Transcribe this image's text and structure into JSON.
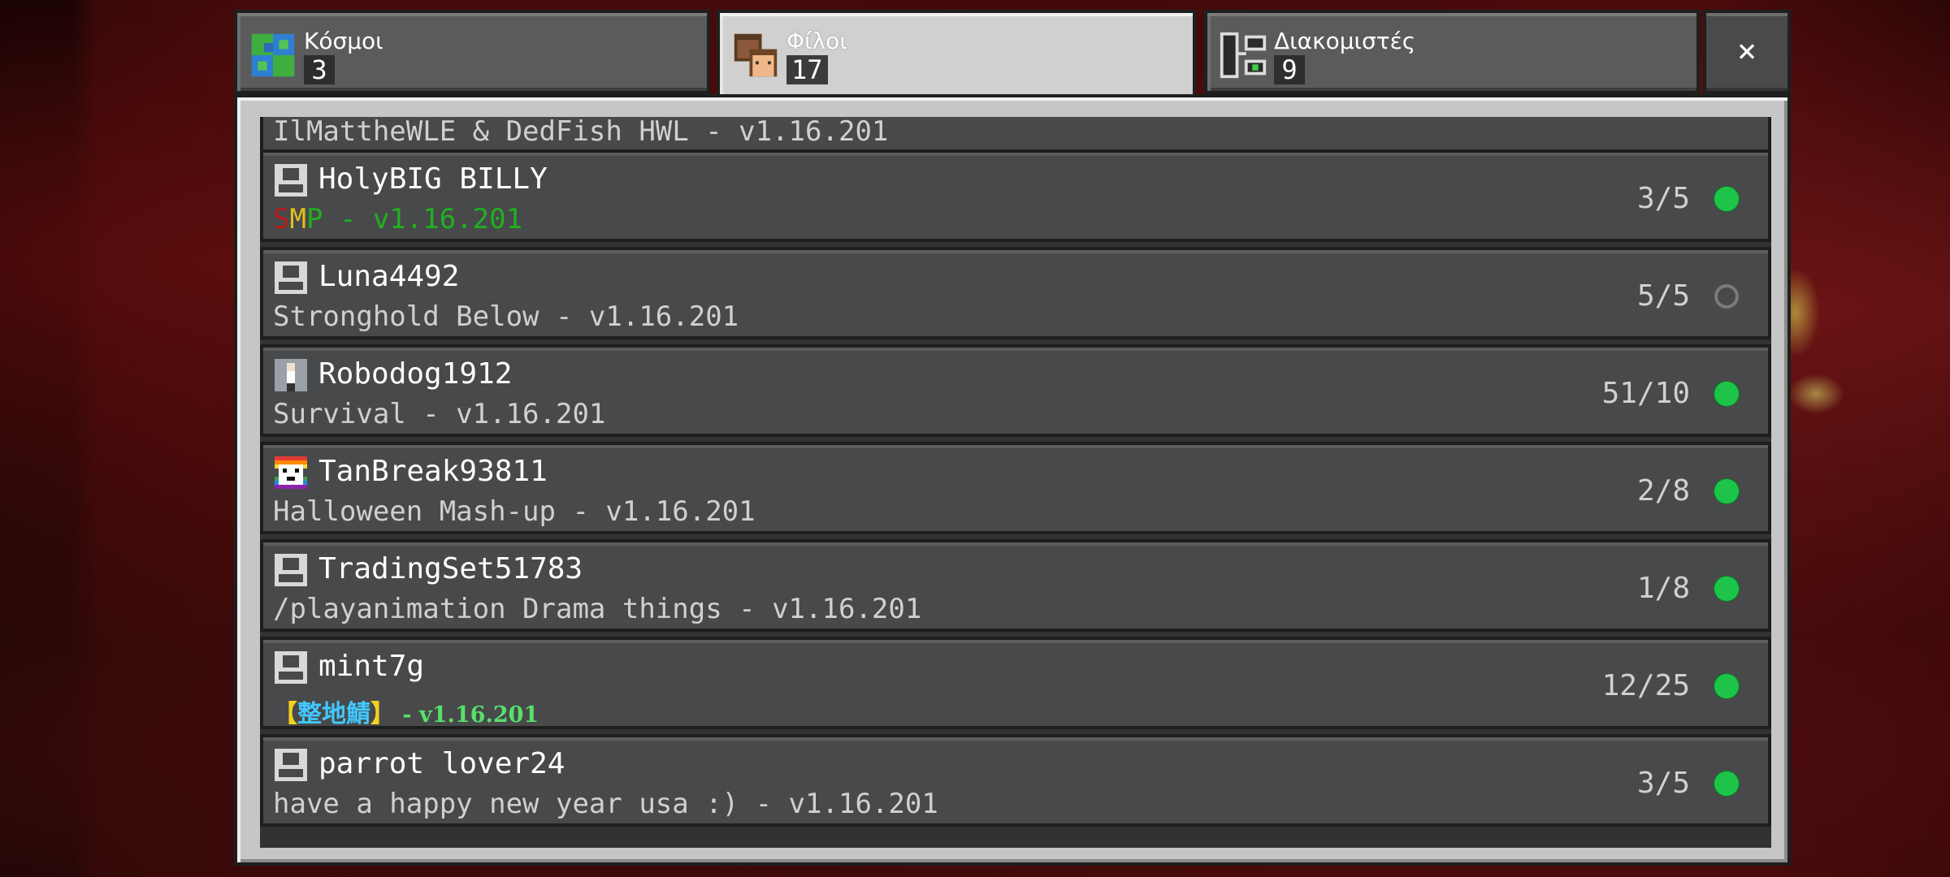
{
  "tabs": [
    {
      "label": "Κόσμοι",
      "count": "3",
      "icon": "world-globe-icon"
    },
    {
      "label": "Φίλοι",
      "count": "17",
      "icon": "friends-icon"
    },
    {
      "label": "Διακομιστές",
      "count": "9",
      "icon": "servers-icon"
    }
  ],
  "close_label": "×",
  "rows": [
    {
      "name": "",
      "desc": "IlMattheWLE & DedFish HWL - v1.16.201",
      "count": "",
      "status": ""
    },
    {
      "name": "HolyBIG BILLY",
      "desc_parts": [
        "S",
        "M",
        "P",
        " - v1.16.201"
      ],
      "count": "3/5",
      "status": "online"
    },
    {
      "name": "Luna4492",
      "desc": "Stronghold Below - v1.16.201",
      "count": "5/5",
      "status": "full"
    },
    {
      "name": "Robodog1912",
      "desc": "Survival - v1.16.201",
      "count": "51/10",
      "status": "online"
    },
    {
      "name": "TanBreak93811",
      "desc": "Halloween Mash-up - v1.16.201",
      "count": "2/8",
      "status": "online"
    },
    {
      "name": "TradingSet51783",
      "desc": "/playanimation Drama things - v1.16.201",
      "count": "1/8",
      "status": "online"
    },
    {
      "name": "mint7g",
      "desc_parts": [
        "【",
        "整地鯖",
        "】",
        " - v1.16.201"
      ],
      "count": "12/25",
      "status": "online"
    },
    {
      "name": "parrot lover24",
      "desc": "have a happy new year usa :) - v1.16.201",
      "count": "3/5",
      "status": "online"
    }
  ],
  "colors": {
    "online": "#1ec44a",
    "smp_s": "#b81d1d",
    "smp_m": "#e0c020",
    "smp_p_rest": "#20b020",
    "mint_bracket": "#f2d21e",
    "mint_cjk": "#42c8ff",
    "mint_version": "#57e06a"
  }
}
